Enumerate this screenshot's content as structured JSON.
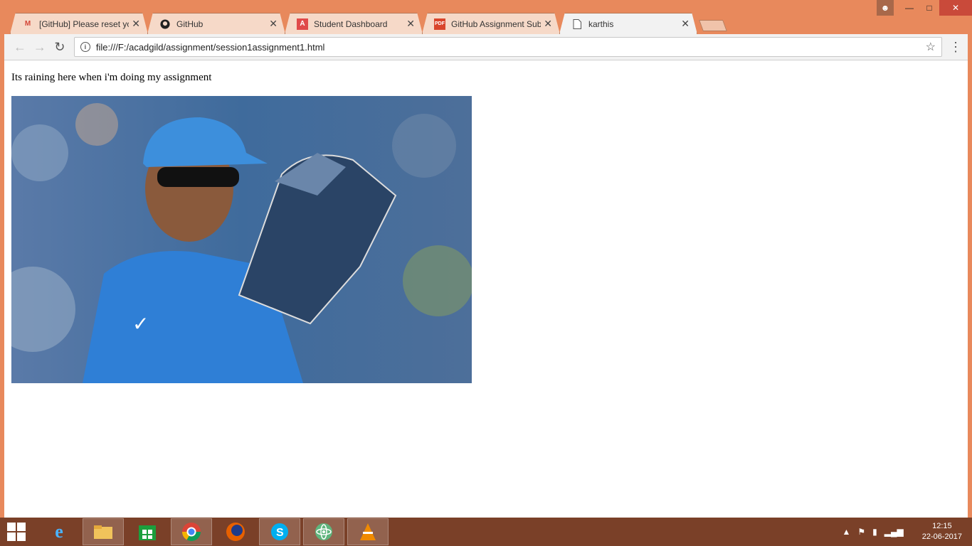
{
  "browser": {
    "tabs": [
      {
        "label": "[GitHub] Please reset you",
        "icon": "gmail-icon",
        "active": false
      },
      {
        "label": "GitHub",
        "icon": "github-icon",
        "active": false
      },
      {
        "label": "Student Dashboard",
        "icon": "acadgild-icon",
        "active": false
      },
      {
        "label": "GitHub Assignment Subm",
        "icon": "pdf-icon",
        "active": false
      },
      {
        "label": "karthis",
        "icon": "page-icon",
        "active": true
      }
    ],
    "url": "file:///F:/acadgild/assignment/session1assignment1.html"
  },
  "page": {
    "text": "Its raining here when i'm doing my assignment",
    "image_alt": "cricketer wearing wicket-keeping gloves"
  },
  "taskbar": {
    "apps": [
      "internet-explorer-icon",
      "file-explorer-icon",
      "store-icon",
      "chrome-icon",
      "firefox-icon",
      "skype-icon",
      "atom-icon",
      "vlc-icon"
    ],
    "time": "12:15",
    "date": "22-06-2017"
  },
  "colors": {
    "window_frame": "#e8895c",
    "taskbar": "#7a4028",
    "close_button": "#c94a3a"
  }
}
